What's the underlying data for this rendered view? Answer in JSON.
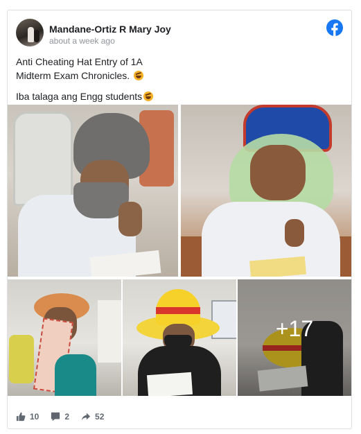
{
  "post": {
    "author": "Mandane-Ortiz R Mary Joy",
    "timestamp": "about a week ago",
    "caption_line1": "Anti Cheating Hat Entry of 1A",
    "caption_line2": "Midterm Exam Chronicles.",
    "caption_line3": "Iba talaga ang Engg students",
    "caption_emoji": "rolling-on-floor-laughing-emoji"
  },
  "gallery": {
    "photos": [
      {
        "name": "student-in-cloth-hood"
      },
      {
        "name": "student-in-floral-headdress"
      },
      {
        "name": "student-in-orange-hat"
      },
      {
        "name": "student-in-straw-hat"
      },
      {
        "name": "student-in-straw-hat-writing"
      }
    ],
    "more_count": "+17"
  },
  "stats": {
    "likes": "10",
    "comments": "2",
    "shares": "52"
  },
  "colors": {
    "facebook_blue": "#1877f2",
    "text_primary": "#1c1e21",
    "text_secondary": "#90949c",
    "footer_text": "#606770"
  }
}
